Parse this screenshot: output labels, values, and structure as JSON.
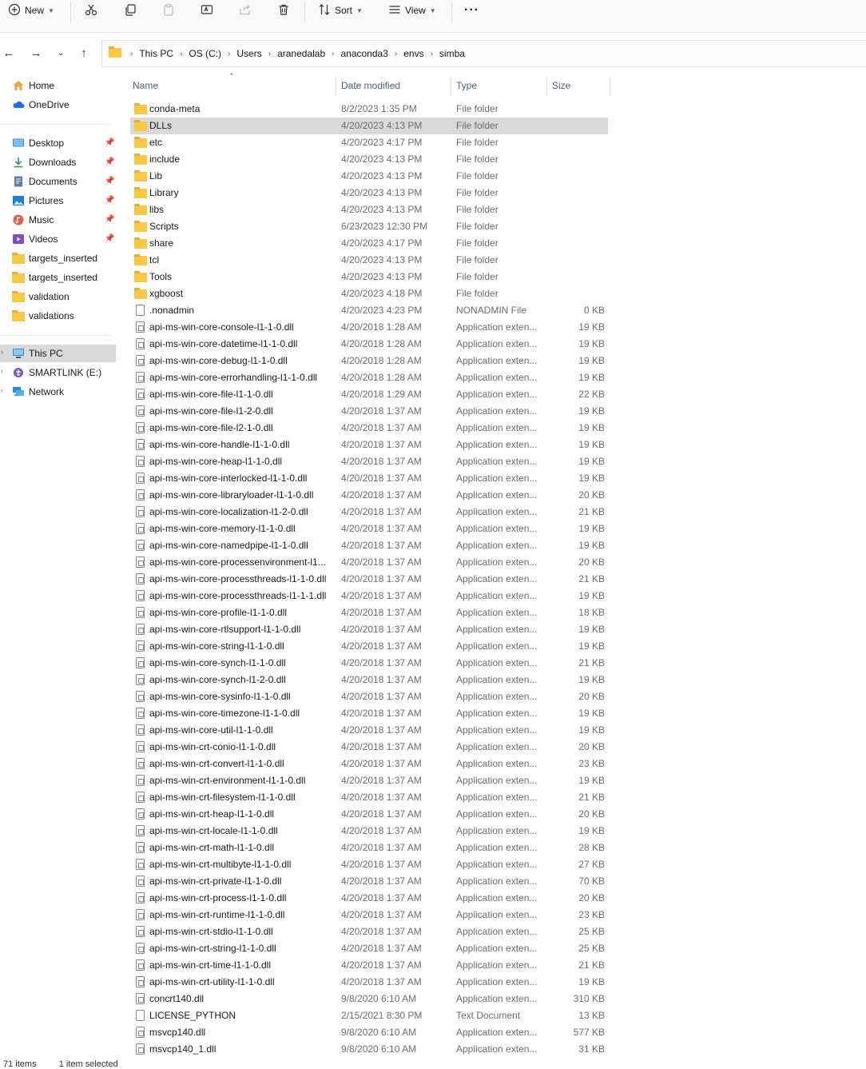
{
  "toolbar": {
    "new_label": "New",
    "sort_label": "Sort",
    "view_label": "View",
    "more_label": "···"
  },
  "breadcrumb": [
    "This PC",
    "OS (C:)",
    "Users",
    "aranedalab",
    "anaconda3",
    "envs",
    "simba"
  ],
  "sidebar": {
    "top": [
      {
        "label": "Home",
        "icon": "home-icon"
      },
      {
        "label": "OneDrive",
        "icon": "cloud-icon"
      }
    ],
    "quick": [
      {
        "label": "Desktop",
        "icon": "desktop-icon",
        "pinned": true
      },
      {
        "label": "Downloads",
        "icon": "download-icon",
        "pinned": true
      },
      {
        "label": "Documents",
        "icon": "document-icon",
        "pinned": true
      },
      {
        "label": "Pictures",
        "icon": "pictures-icon",
        "pinned": true
      },
      {
        "label": "Music",
        "icon": "music-icon",
        "pinned": true
      },
      {
        "label": "Videos",
        "icon": "videos-icon",
        "pinned": true
      },
      {
        "label": "targets_inserted",
        "icon": "folder-icon",
        "pinned": false
      },
      {
        "label": "targets_inserted",
        "icon": "folder-icon",
        "pinned": false
      },
      {
        "label": "validation",
        "icon": "folder-icon",
        "pinned": false
      },
      {
        "label": "validations",
        "icon": "folder-icon",
        "pinned": false
      }
    ],
    "devices": [
      {
        "label": "This PC",
        "icon": "pc-icon",
        "selected": true
      },
      {
        "label": "SMARTLINK (E:)",
        "icon": "usb-drive-icon"
      },
      {
        "label": "Network",
        "icon": "network-icon"
      }
    ]
  },
  "columns": {
    "name": "Name",
    "date": "Date modified",
    "type": "Type",
    "size": "Size"
  },
  "files": [
    {
      "name": "conda-meta",
      "date": "8/2/2023 1:35 PM",
      "type": "File folder",
      "size": "",
      "kind": "folder"
    },
    {
      "name": "DLLs",
      "date": "4/20/2023 4:13 PM",
      "type": "File folder",
      "size": "",
      "kind": "folder",
      "selected": true
    },
    {
      "name": "etc",
      "date": "4/20/2023 4:17 PM",
      "type": "File folder",
      "size": "",
      "kind": "folder"
    },
    {
      "name": "include",
      "date": "4/20/2023 4:13 PM",
      "type": "File folder",
      "size": "",
      "kind": "folder"
    },
    {
      "name": "Lib",
      "date": "4/20/2023 4:13 PM",
      "type": "File folder",
      "size": "",
      "kind": "folder"
    },
    {
      "name": "Library",
      "date": "4/20/2023 4:13 PM",
      "type": "File folder",
      "size": "",
      "kind": "folder"
    },
    {
      "name": "libs",
      "date": "4/20/2023 4:13 PM",
      "type": "File folder",
      "size": "",
      "kind": "folder"
    },
    {
      "name": "Scripts",
      "date": "6/23/2023 12:30 PM",
      "type": "File folder",
      "size": "",
      "kind": "folder"
    },
    {
      "name": "share",
      "date": "4/20/2023 4:17 PM",
      "type": "File folder",
      "size": "",
      "kind": "folder"
    },
    {
      "name": "tcl",
      "date": "4/20/2023 4:13 PM",
      "type": "File folder",
      "size": "",
      "kind": "folder"
    },
    {
      "name": "Tools",
      "date": "4/20/2023 4:13 PM",
      "type": "File folder",
      "size": "",
      "kind": "folder"
    },
    {
      "name": "xgboost",
      "date": "4/20/2023 4:18 PM",
      "type": "File folder",
      "size": "",
      "kind": "folder"
    },
    {
      "name": ".nonadmin",
      "date": "4/20/2023 4:23 PM",
      "type": "NONADMIN File",
      "size": "0 KB",
      "kind": "file"
    },
    {
      "name": "api-ms-win-core-console-l1-1-0.dll",
      "date": "4/20/2018 1:28 AM",
      "type": "Application exten...",
      "size": "19 KB",
      "kind": "dll"
    },
    {
      "name": "api-ms-win-core-datetime-l1-1-0.dll",
      "date": "4/20/2018 1:28 AM",
      "type": "Application exten...",
      "size": "19 KB",
      "kind": "dll"
    },
    {
      "name": "api-ms-win-core-debug-l1-1-0.dll",
      "date": "4/20/2018 1:28 AM",
      "type": "Application exten...",
      "size": "19 KB",
      "kind": "dll"
    },
    {
      "name": "api-ms-win-core-errorhandling-l1-1-0.dll",
      "date": "4/20/2018 1:28 AM",
      "type": "Application exten...",
      "size": "19 KB",
      "kind": "dll"
    },
    {
      "name": "api-ms-win-core-file-l1-1-0.dll",
      "date": "4/20/2018 1:29 AM",
      "type": "Application exten...",
      "size": "22 KB",
      "kind": "dll"
    },
    {
      "name": "api-ms-win-core-file-l1-2-0.dll",
      "date": "4/20/2018 1:37 AM",
      "type": "Application exten...",
      "size": "19 KB",
      "kind": "dll"
    },
    {
      "name": "api-ms-win-core-file-l2-1-0.dll",
      "date": "4/20/2018 1:37 AM",
      "type": "Application exten...",
      "size": "19 KB",
      "kind": "dll"
    },
    {
      "name": "api-ms-win-core-handle-l1-1-0.dll",
      "date": "4/20/2018 1:37 AM",
      "type": "Application exten...",
      "size": "19 KB",
      "kind": "dll"
    },
    {
      "name": "api-ms-win-core-heap-l1-1-0.dll",
      "date": "4/20/2018 1:37 AM",
      "type": "Application exten...",
      "size": "19 KB",
      "kind": "dll"
    },
    {
      "name": "api-ms-win-core-interlocked-l1-1-0.dll",
      "date": "4/20/2018 1:37 AM",
      "type": "Application exten...",
      "size": "19 KB",
      "kind": "dll"
    },
    {
      "name": "api-ms-win-core-libraryloader-l1-1-0.dll",
      "date": "4/20/2018 1:37 AM",
      "type": "Application exten...",
      "size": "20 KB",
      "kind": "dll"
    },
    {
      "name": "api-ms-win-core-localization-l1-2-0.dll",
      "date": "4/20/2018 1:37 AM",
      "type": "Application exten...",
      "size": "21 KB",
      "kind": "dll"
    },
    {
      "name": "api-ms-win-core-memory-l1-1-0.dll",
      "date": "4/20/2018 1:37 AM",
      "type": "Application exten...",
      "size": "19 KB",
      "kind": "dll"
    },
    {
      "name": "api-ms-win-core-namedpipe-l1-1-0.dll",
      "date": "4/20/2018 1:37 AM",
      "type": "Application exten...",
      "size": "19 KB",
      "kind": "dll"
    },
    {
      "name": "api-ms-win-core-processenvironment-l1...",
      "date": "4/20/2018 1:37 AM",
      "type": "Application exten...",
      "size": "20 KB",
      "kind": "dll"
    },
    {
      "name": "api-ms-win-core-processthreads-l1-1-0.dll",
      "date": "4/20/2018 1:37 AM",
      "type": "Application exten...",
      "size": "21 KB",
      "kind": "dll"
    },
    {
      "name": "api-ms-win-core-processthreads-l1-1-1.dll",
      "date": "4/20/2018 1:37 AM",
      "type": "Application exten...",
      "size": "19 KB",
      "kind": "dll"
    },
    {
      "name": "api-ms-win-core-profile-l1-1-0.dll",
      "date": "4/20/2018 1:37 AM",
      "type": "Application exten...",
      "size": "18 KB",
      "kind": "dll"
    },
    {
      "name": "api-ms-win-core-rtlsupport-l1-1-0.dll",
      "date": "4/20/2018 1:37 AM",
      "type": "Application exten...",
      "size": "19 KB",
      "kind": "dll"
    },
    {
      "name": "api-ms-win-core-string-l1-1-0.dll",
      "date": "4/20/2018 1:37 AM",
      "type": "Application exten...",
      "size": "19 KB",
      "kind": "dll"
    },
    {
      "name": "api-ms-win-core-synch-l1-1-0.dll",
      "date": "4/20/2018 1:37 AM",
      "type": "Application exten...",
      "size": "21 KB",
      "kind": "dll"
    },
    {
      "name": "api-ms-win-core-synch-l1-2-0.dll",
      "date": "4/20/2018 1:37 AM",
      "type": "Application exten...",
      "size": "19 KB",
      "kind": "dll"
    },
    {
      "name": "api-ms-win-core-sysinfo-l1-1-0.dll",
      "date": "4/20/2018 1:37 AM",
      "type": "Application exten...",
      "size": "20 KB",
      "kind": "dll"
    },
    {
      "name": "api-ms-win-core-timezone-l1-1-0.dll",
      "date": "4/20/2018 1:37 AM",
      "type": "Application exten...",
      "size": "19 KB",
      "kind": "dll"
    },
    {
      "name": "api-ms-win-core-util-l1-1-0.dll",
      "date": "4/20/2018 1:37 AM",
      "type": "Application exten...",
      "size": "19 KB",
      "kind": "dll"
    },
    {
      "name": "api-ms-win-crt-conio-l1-1-0.dll",
      "date": "4/20/2018 1:37 AM",
      "type": "Application exten...",
      "size": "20 KB",
      "kind": "dll"
    },
    {
      "name": "api-ms-win-crt-convert-l1-1-0.dll",
      "date": "4/20/2018 1:37 AM",
      "type": "Application exten...",
      "size": "23 KB",
      "kind": "dll"
    },
    {
      "name": "api-ms-win-crt-environment-l1-1-0.dll",
      "date": "4/20/2018 1:37 AM",
      "type": "Application exten...",
      "size": "19 KB",
      "kind": "dll"
    },
    {
      "name": "api-ms-win-crt-filesystem-l1-1-0.dll",
      "date": "4/20/2018 1:37 AM",
      "type": "Application exten...",
      "size": "21 KB",
      "kind": "dll"
    },
    {
      "name": "api-ms-win-crt-heap-l1-1-0.dll",
      "date": "4/20/2018 1:37 AM",
      "type": "Application exten...",
      "size": "20 KB",
      "kind": "dll"
    },
    {
      "name": "api-ms-win-crt-locale-l1-1-0.dll",
      "date": "4/20/2018 1:37 AM",
      "type": "Application exten...",
      "size": "19 KB",
      "kind": "dll"
    },
    {
      "name": "api-ms-win-crt-math-l1-1-0.dll",
      "date": "4/20/2018 1:37 AM",
      "type": "Application exten...",
      "size": "28 KB",
      "kind": "dll"
    },
    {
      "name": "api-ms-win-crt-multibyte-l1-1-0.dll",
      "date": "4/20/2018 1:37 AM",
      "type": "Application exten...",
      "size": "27 KB",
      "kind": "dll"
    },
    {
      "name": "api-ms-win-crt-private-l1-1-0.dll",
      "date": "4/20/2018 1:37 AM",
      "type": "Application exten...",
      "size": "70 KB",
      "kind": "dll"
    },
    {
      "name": "api-ms-win-crt-process-l1-1-0.dll",
      "date": "4/20/2018 1:37 AM",
      "type": "Application exten...",
      "size": "20 KB",
      "kind": "dll"
    },
    {
      "name": "api-ms-win-crt-runtime-l1-1-0.dll",
      "date": "4/20/2018 1:37 AM",
      "type": "Application exten...",
      "size": "23 KB",
      "kind": "dll"
    },
    {
      "name": "api-ms-win-crt-stdio-l1-1-0.dll",
      "date": "4/20/2018 1:37 AM",
      "type": "Application exten...",
      "size": "25 KB",
      "kind": "dll"
    },
    {
      "name": "api-ms-win-crt-string-l1-1-0.dll",
      "date": "4/20/2018 1:37 AM",
      "type": "Application exten...",
      "size": "25 KB",
      "kind": "dll"
    },
    {
      "name": "api-ms-win-crt-time-l1-1-0.dll",
      "date": "4/20/2018 1:37 AM",
      "type": "Application exten...",
      "size": "21 KB",
      "kind": "dll"
    },
    {
      "name": "api-ms-win-crt-utility-l1-1-0.dll",
      "date": "4/20/2018 1:37 AM",
      "type": "Application exten...",
      "size": "19 KB",
      "kind": "dll"
    },
    {
      "name": "concrt140.dll",
      "date": "9/8/2020 6:10 AM",
      "type": "Application exten...",
      "size": "310 KB",
      "kind": "dll"
    },
    {
      "name": "LICENSE_PYTHON",
      "date": "2/15/2021 8:30 PM",
      "type": "Text Document",
      "size": "13 KB",
      "kind": "file"
    },
    {
      "name": "msvcp140.dll",
      "date": "9/8/2020 6:10 AM",
      "type": "Application exten...",
      "size": "577 KB",
      "kind": "dll"
    },
    {
      "name": "msvcp140_1.dll",
      "date": "9/8/2020 6:10 AM",
      "type": "Application exten...",
      "size": "31 KB",
      "kind": "dll"
    }
  ],
  "status": {
    "items": "71 items",
    "selected": "1 item selected"
  },
  "colors": {
    "folder": "#f8c744",
    "selected_row": "#d9d9d9",
    "header_text": "#4c6088",
    "muted_text": "#6d6d6d"
  }
}
